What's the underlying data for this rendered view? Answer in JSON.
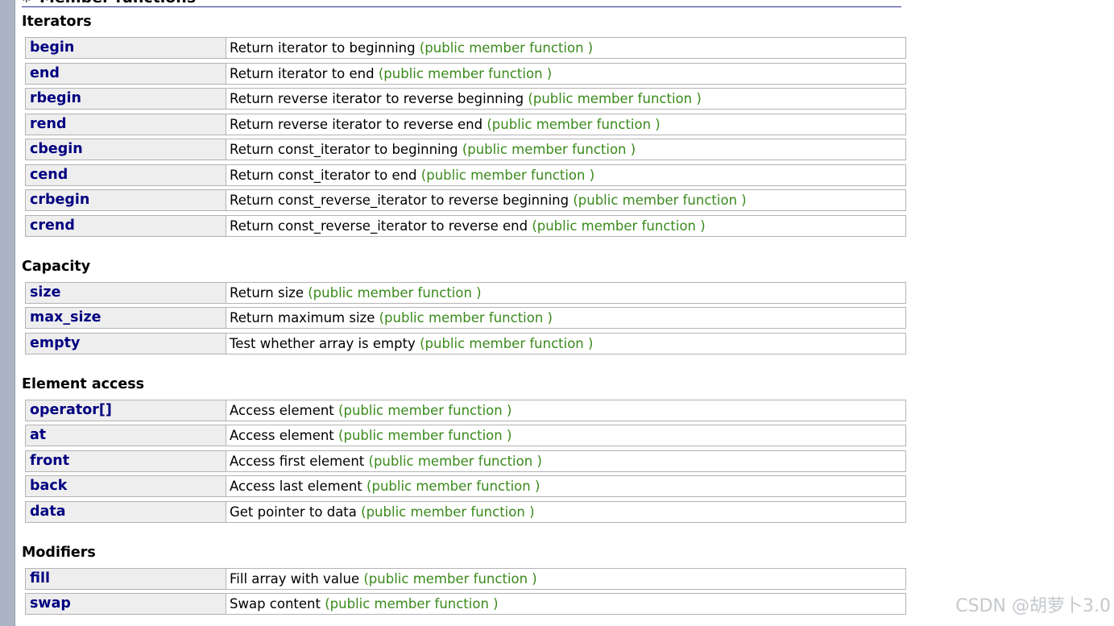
{
  "heading": "Member functions",
  "sections": [
    {
      "title": "Iterators",
      "items": [
        {
          "name": "begin",
          "desc": "Return iterator to beginning",
          "tag": "(public member function )"
        },
        {
          "name": "end",
          "desc": "Return iterator to end",
          "tag": "(public member function )"
        },
        {
          "name": "rbegin",
          "desc": "Return reverse iterator to reverse beginning",
          "tag": "(public member function )"
        },
        {
          "name": "rend",
          "desc": "Return reverse iterator to reverse end",
          "tag": "(public member function )"
        },
        {
          "name": "cbegin",
          "desc": "Return const_iterator to beginning",
          "tag": "(public member function )"
        },
        {
          "name": "cend",
          "desc": "Return const_iterator to end",
          "tag": "(public member function )"
        },
        {
          "name": "crbegin",
          "desc": "Return const_reverse_iterator to reverse beginning",
          "tag": "(public member function )"
        },
        {
          "name": "crend",
          "desc": "Return const_reverse_iterator to reverse end",
          "tag": "(public member function )"
        }
      ]
    },
    {
      "title": "Capacity",
      "items": [
        {
          "name": "size",
          "desc": "Return size",
          "tag": "(public member function )"
        },
        {
          "name": "max_size",
          "desc": "Return maximum size",
          "tag": "(public member function )"
        },
        {
          "name": "empty",
          "desc": "Test whether array is empty",
          "tag": "(public member function )"
        }
      ]
    },
    {
      "title": "Element access",
      "items": [
        {
          "name": "operator[]",
          "desc": "Access element",
          "tag": "(public member function )"
        },
        {
          "name": "at",
          "desc": "Access element",
          "tag": "(public member function )"
        },
        {
          "name": "front",
          "desc": "Access first element",
          "tag": "(public member function )"
        },
        {
          "name": "back",
          "desc": "Access last element",
          "tag": "(public member function )"
        },
        {
          "name": "data",
          "desc": "Get pointer to data",
          "tag": "(public member function )"
        }
      ]
    },
    {
      "title": "Modifiers",
      "items": [
        {
          "name": "fill",
          "desc": "Fill array with value",
          "tag": "(public member function )"
        },
        {
          "name": "swap",
          "desc": "Swap content",
          "tag": "(public member function )"
        }
      ]
    }
  ],
  "watermark": "CSDN @胡萝卜3.0"
}
